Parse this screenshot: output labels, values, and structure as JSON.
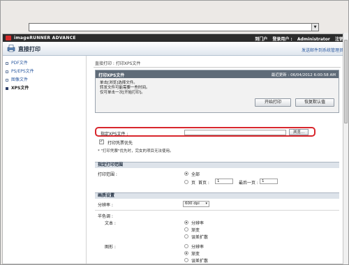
{
  "browser": {
    "address_value": "",
    "dropdown_glyph": "▼"
  },
  "topbar": {
    "brand": "imageRUNNER ADVANCE",
    "nav": [
      "到门户",
      "登录用户 :",
      "Administrator",
      "注销"
    ]
  },
  "header": {
    "title": "直接打印",
    "mail_link": "发送邮件到系统管理员"
  },
  "sidebar": {
    "items": [
      {
        "label": "PDF文件",
        "active": false
      },
      {
        "label": "PS/EPS文件",
        "active": false
      },
      {
        "label": "图像文件",
        "active": false
      },
      {
        "label": "XPS文件",
        "active": true
      }
    ]
  },
  "breadcrumb": "直接打印 : 打印XPS文件",
  "panel": {
    "title": "打印XPS文件",
    "meta": "最近更新 : 06/04/2012 6:00:58 AM",
    "instructions": [
      "单击[浏览]选择文件。",
      "转发文件可能需要一些时间。",
      "仅可单击一次[开始打印]。"
    ],
    "start_print": "开始打印",
    "restore_defaults": "恢复默认值"
  },
  "file": {
    "label": "指定XPS文件 :",
    "value": "",
    "browse": "浏览..."
  },
  "ticket_priority": {
    "label": "打印凭票优先",
    "checked": true
  },
  "note": "* \"打印凭票\"优先时，完女的项目无法使用。",
  "print_range": {
    "section": "指定打印范围",
    "label": "打印范围 :",
    "all": "全部",
    "pages": "页",
    "first_page_label": "首页 :",
    "first_page_value": "1",
    "last_page_label": "最后一页 :",
    "last_page_value": "1"
  },
  "quality": {
    "section": "画质设置",
    "resolution_label": "分辨率 :",
    "resolution_value": "600 dpi",
    "halftone_label": "半色调 :",
    "text_label": "文本 :",
    "graphics_label": "图形 :",
    "options": [
      "分辨率",
      "渐变",
      "误差扩散"
    ],
    "text_selected": 0,
    "graphics_selected": 1
  }
}
